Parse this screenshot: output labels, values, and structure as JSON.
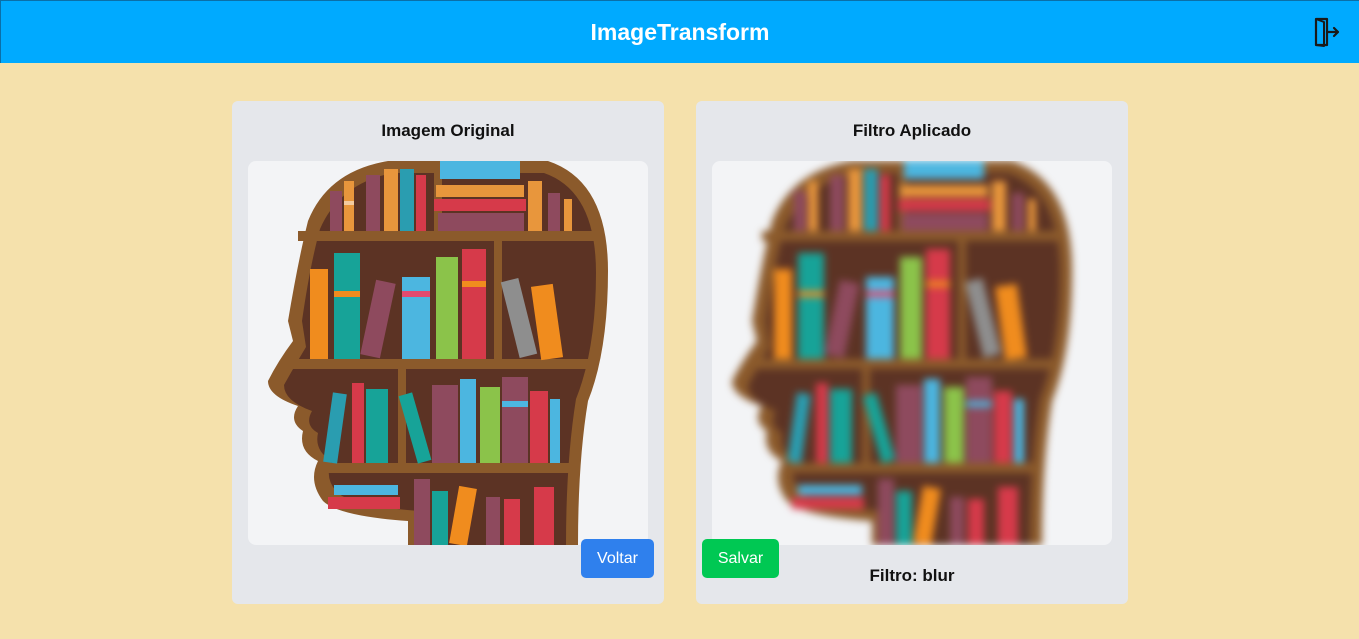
{
  "header": {
    "title": "ImageTransform",
    "logout_icon": "logout-door-icon"
  },
  "original_card": {
    "title": "Imagem Original",
    "image_description": "head-shaped-bookshelf",
    "back_button": "Voltar"
  },
  "filtered_card": {
    "title": "Filtro Aplicado",
    "save_button": "Salvar",
    "filter_label": "Filtro: blur"
  },
  "colors": {
    "header": "#00aaff",
    "background": "#f5e1ac",
    "card": "#e5e7eb",
    "voltar_button": "#2f80ed",
    "salvar_button": "#00c853",
    "shelf_wood": "#8b5a2b",
    "shelf_interior": "#5c3324"
  }
}
